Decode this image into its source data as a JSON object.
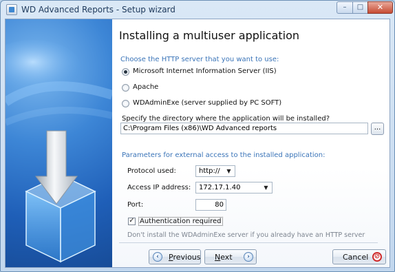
{
  "window": {
    "title": "WD Advanced Reports - Setup wizard",
    "controls": {
      "minimize": "–",
      "maximize": "□",
      "close": "✕"
    }
  },
  "page": {
    "heading": "Installing a multiuser application"
  },
  "server": {
    "prompt": "Choose the HTTP server that you want to use:",
    "options": [
      {
        "label": "Microsoft Internet Information Server (IIS)",
        "selected": true
      },
      {
        "label": "Apache",
        "selected": false
      },
      {
        "label": "WDAdminExe (server supplied by PC SOFT)",
        "selected": false
      }
    ]
  },
  "directory": {
    "prompt": "Specify the directory where the application will be installed?",
    "value": "C:\\Program Files (x86)\\WD Advanced reports",
    "browse_label": "..."
  },
  "external": {
    "prompt": "Parameters for external access to the installed application:",
    "protocol_label": "Protocol used:",
    "protocol_value": "http://",
    "ip_label": "Access IP address:",
    "ip_value": "172.17.1.40",
    "port_label": "Port:",
    "port_value": "80",
    "auth_label": "Authentication required",
    "auth_checked": true,
    "hint": "Don't install the WDAdminExe server if you already have an HTTP server"
  },
  "buttons": {
    "previous": {
      "mnemonic": "P",
      "rest": "revious",
      "icon": "‹"
    },
    "next": {
      "mnemonic": "N",
      "rest": "ext",
      "icon": "›"
    },
    "cancel": {
      "label": "Cancel",
      "icon": "⊘"
    }
  },
  "colors": {
    "accent_text": "#3a74b8",
    "side_panel": "#2a6fc4"
  },
  "icons": [
    "app-icon",
    "minimize-icon",
    "maximize-icon",
    "close-icon",
    "download-box-illustration",
    "previous-arrow-icon",
    "next-arrow-icon",
    "cancel-icon"
  ]
}
